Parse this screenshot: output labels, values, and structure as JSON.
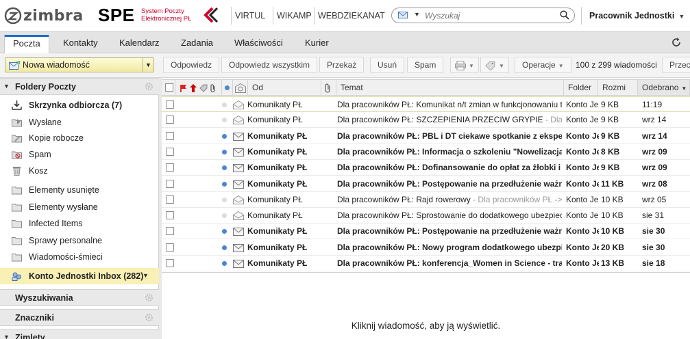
{
  "header": {
    "logo_text": "zimbra",
    "spe_title": "SPE",
    "spe_subtitle_line1": "System Poczty",
    "spe_subtitle_line2": "Elektronicznej PŁ",
    "links": [
      "VIRTUL",
      "WIKAMP",
      "WEBDZIEKANAT"
    ],
    "search_placeholder": "Wyszukaj",
    "user_name": "Pracownik Jednostki"
  },
  "tabs": [
    {
      "label": "Poczta",
      "active": true
    },
    {
      "label": "Kontakty",
      "active": false
    },
    {
      "label": "Kalendarz",
      "active": false
    },
    {
      "label": "Zadania",
      "active": false
    },
    {
      "label": "Właściwości",
      "active": false
    },
    {
      "label": "Kurier",
      "active": false
    }
  ],
  "toolbar": {
    "new_message": "Nowa wiadomość",
    "reply": "Odpowiedz",
    "reply_all": "Odpowiedz wszystkim",
    "forward": "Przekaż",
    "delete": "Usuń",
    "spam": "Spam",
    "operations": "Operacje",
    "count": "100 z 299 wiadomości",
    "next": "Przec"
  },
  "sidebar": {
    "mail_folders_header": "Foldery Poczty",
    "folders": [
      {
        "label": "Skrzynka odbiorcza (7)",
        "icon": "inbox-icon",
        "bold": true
      },
      {
        "label": "Wysłane",
        "icon": "sent-folder-icon",
        "bold": false
      },
      {
        "label": "Kopie robocze",
        "icon": "drafts-icon",
        "bold": false
      },
      {
        "label": "Spam",
        "icon": "spam-icon",
        "bold": false
      },
      {
        "label": "Kosz",
        "icon": "trash-icon",
        "bold": false
      },
      {
        "label": "Elementy usunięte",
        "icon": "folder-icon",
        "bold": false
      },
      {
        "label": "Elementy wysłane",
        "icon": "folder-icon",
        "bold": false
      },
      {
        "label": "Infected Items",
        "icon": "folder-icon",
        "bold": false
      },
      {
        "label": "Sprawy personalne",
        "icon": "folder-icon",
        "bold": false
      },
      {
        "label": "Wiadomości-śmieci",
        "icon": "folder-icon",
        "bold": false
      }
    ],
    "shared_account": "Konto Jednostki Inbox (282)",
    "searches_header": "Wyszukiwania",
    "tags_header": "Znaczniki",
    "zimlets_header": "Zimlety"
  },
  "columns": {
    "from": "Od",
    "subject": "Temat",
    "folder": "Folder",
    "size": "Rozmi",
    "received": "Odebrano"
  },
  "messages": [
    {
      "from": "Komunikaty PŁ",
      "subject": "Dla pracowników PŁ: Komunikat n/t zmian w funkcjonowaniu tr",
      "fragment": "",
      "folder": "Konto Je",
      "size": "9 KB",
      "date": "11:19",
      "unread": false
    },
    {
      "from": "Komunikaty PŁ",
      "subject": "Dla pracowników PŁ: SZCZEPIENIA PRZECIW GRYPIE",
      "fragment": " - Dla",
      "folder": "Konto Je",
      "size": "9 KB",
      "date": "wrz 14",
      "unread": false
    },
    {
      "from": "Komunikaty PŁ",
      "subject": "Dla pracowników PŁ: PBL i DT ciekawe spotkanie z eksper",
      "fragment": "",
      "folder": "Konto Je",
      "size": "9 KB",
      "date": "wrz 14",
      "unread": true
    },
    {
      "from": "Komunikaty PŁ",
      "subject": "Dla pracowników PŁ: Informacja o szkoleniu \"Nowelizacja",
      "fragment": "",
      "folder": "Konto Je",
      "size": "8 KB",
      "date": "wrz 09",
      "unread": true
    },
    {
      "from": "Komunikaty PŁ",
      "subject": "Dla pracowników PŁ: Dofinansowanie do opłat za żłobki i",
      "fragment": "",
      "folder": "Konto Je",
      "size": "9 KB",
      "date": "wrz 09",
      "unread": true
    },
    {
      "from": "Komunikaty PŁ",
      "subject": "Dla pracowników PŁ: Postępowanie na przedłużenie ważn",
      "fragment": "",
      "folder": "Konto Je",
      "size": "11 KB",
      "date": "wrz 08",
      "unread": true
    },
    {
      "from": "Komunikaty PŁ",
      "subject": "Dla pracowników PŁ: Rajd rowerowy",
      "fragment": " - Dla pracowników PŁ ->",
      "folder": "Konto Je",
      "size": "10 KB",
      "date": "wrz 05",
      "unread": false
    },
    {
      "from": "Komunikaty PŁ",
      "subject": "Dla pracowników PŁ: Sprostowanie do dodatkowego ubezpiec",
      "fragment": "",
      "folder": "Konto Je",
      "size": "10 KB",
      "date": "sie 31",
      "unread": false
    },
    {
      "from": "Komunikaty PŁ",
      "subject": "Dla pracowników PŁ: Postępowanie na przedłużenie ważn",
      "fragment": "",
      "folder": "Konto Je",
      "size": "10 KB",
      "date": "sie 30",
      "unread": true
    },
    {
      "from": "Komunikaty PŁ",
      "subject": "Dla pracowników PŁ: Nowy program dodatkowego ubezpi",
      "fragment": "",
      "folder": "Konto Je",
      "size": "20 KB",
      "date": "sie 30",
      "unread": true
    },
    {
      "from": "Komunikaty PŁ",
      "subject": "Dla pracowników PŁ: konferencja_Women in Science - tra",
      "fragment": "",
      "folder": "Konto Je",
      "size": "13 KB",
      "date": "sie 18",
      "unread": true
    }
  ],
  "reading_pane": {
    "hint": "Kliknij wiadomość, aby ją wyświetlić."
  },
  "colors": {
    "accent": "#1a6fc7",
    "unread_dot": "#4a86d4",
    "selected_folder": "#f8f0b4",
    "brand_red": "#d4002a"
  }
}
